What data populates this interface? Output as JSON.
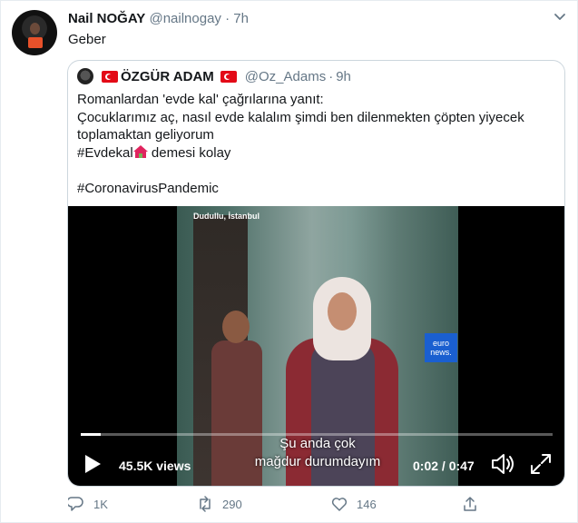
{
  "tweet": {
    "author_name": "Nail NOĞAY",
    "handle": "@nailnogay",
    "separator": "·",
    "time": "7h",
    "text": "Geber"
  },
  "quoted": {
    "author_name": "ÖZGÜR ADAM",
    "handle": "@Oz_Adams",
    "separator": "·",
    "time": "9h",
    "lines": [
      "Romanlardan 'evde kal' çağrılarına yanıt:",
      "Çocuklarımız aç, nasıl evde kalalım şimdi ben dilenmekten çöpten yiyecek",
      "toplamaktan geliyorum"
    ],
    "hashtag1": "#Evdekal",
    "hashtag1_suffix": "demesi kolay",
    "hashtag2": "#CoronavirusPandemic"
  },
  "video": {
    "location": "Dudullu, İstanbul",
    "brand_line1": "euro",
    "brand_line2": "news.",
    "subtitle_line1": "Şu anda çok",
    "subtitle_line2": "mağdur durumdayım",
    "views": "45.5K views",
    "timecode": "0:02 / 0:47",
    "progress_fraction": 0.042
  },
  "actions": {
    "reply_count": "1K",
    "retweet_count": "290",
    "like_count": "146"
  },
  "icons": [
    "caret-down-icon",
    "play-icon",
    "volume-icon",
    "fullscreen-icon",
    "reply-icon",
    "retweet-icon",
    "like-icon",
    "share-icon",
    "turkish-flag-icon",
    "house-icon"
  ],
  "colors": {
    "text": "#14171a",
    "secondary": "#657786",
    "border": "#ccd6dd",
    "flag_red": "#e30a17",
    "euronews_blue": "#1a5fd0"
  }
}
